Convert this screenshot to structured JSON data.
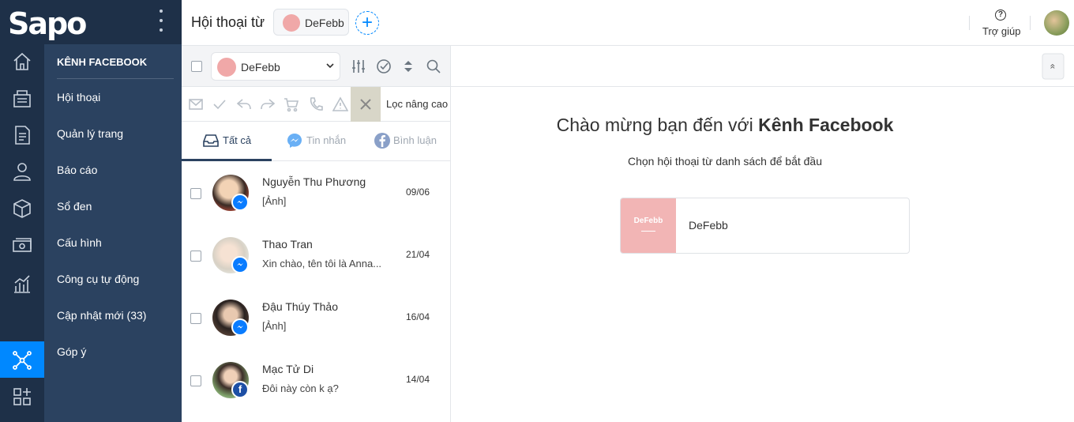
{
  "app": {
    "logo_text": "Sapo"
  },
  "sidebar": {
    "section_title": "KÊNH FACEBOOK",
    "items": [
      {
        "label": "Hội thoại"
      },
      {
        "label": "Quản lý trang"
      },
      {
        "label": "Báo cáo"
      },
      {
        "label": "Sổ đen"
      },
      {
        "label": "Cấu hình"
      },
      {
        "label": "Công cụ tự động"
      },
      {
        "label": "Cập nhật mới (33)"
      },
      {
        "label": "Góp ý"
      }
    ],
    "rail_icons": [
      "home-icon",
      "orders-icon",
      "document-icon",
      "user-icon",
      "box-icon",
      "money-icon",
      "chart-icon",
      "network-icon",
      "apps-icon"
    ]
  },
  "header": {
    "title": "Hội thoại từ",
    "page_chip": "DeFebb",
    "add_label": "+",
    "help_icon": "?",
    "help_label": "Trợ giúp"
  },
  "list_panel": {
    "page_select_value": "DeFebb",
    "advanced_filter": "Lọc nâng cao",
    "tabs": [
      {
        "label": "Tất cả",
        "active": true
      },
      {
        "label": "Tin nhắn",
        "active": false
      },
      {
        "label": "Bình luận",
        "active": false
      }
    ],
    "conversations": [
      {
        "name": "Nguyễn Thu Phương",
        "snippet": "[Ảnh]",
        "date": "09/06",
        "channel": "messenger"
      },
      {
        "name": "Thao Tran",
        "snippet": "Xin chào, tên tôi là Anna...",
        "date": "21/04",
        "channel": "messenger"
      },
      {
        "name": "Đậu Thúy Thảo",
        "snippet": "[Ảnh]",
        "date": "16/04",
        "channel": "messenger"
      },
      {
        "name": "Mạc Tử Di",
        "snippet": "Đôi này còn k ạ?",
        "date": "14/04",
        "channel": "facebook"
      }
    ]
  },
  "main": {
    "welcome_prefix": "Chào mừng bạn đến với",
    "welcome_bold": "Kênh Facebook",
    "subtitle": "Chọn hội thoại từ danh sách để bắt đầu",
    "page_card_thumb": "DeFebb",
    "page_card_name": "DeFebb",
    "collapse_label": "«"
  },
  "colors": {
    "rail_bg": "#1e3048",
    "submenu_bg": "#2b4260",
    "accent": "#0088ff",
    "page_pink": "#f2b5b5"
  }
}
